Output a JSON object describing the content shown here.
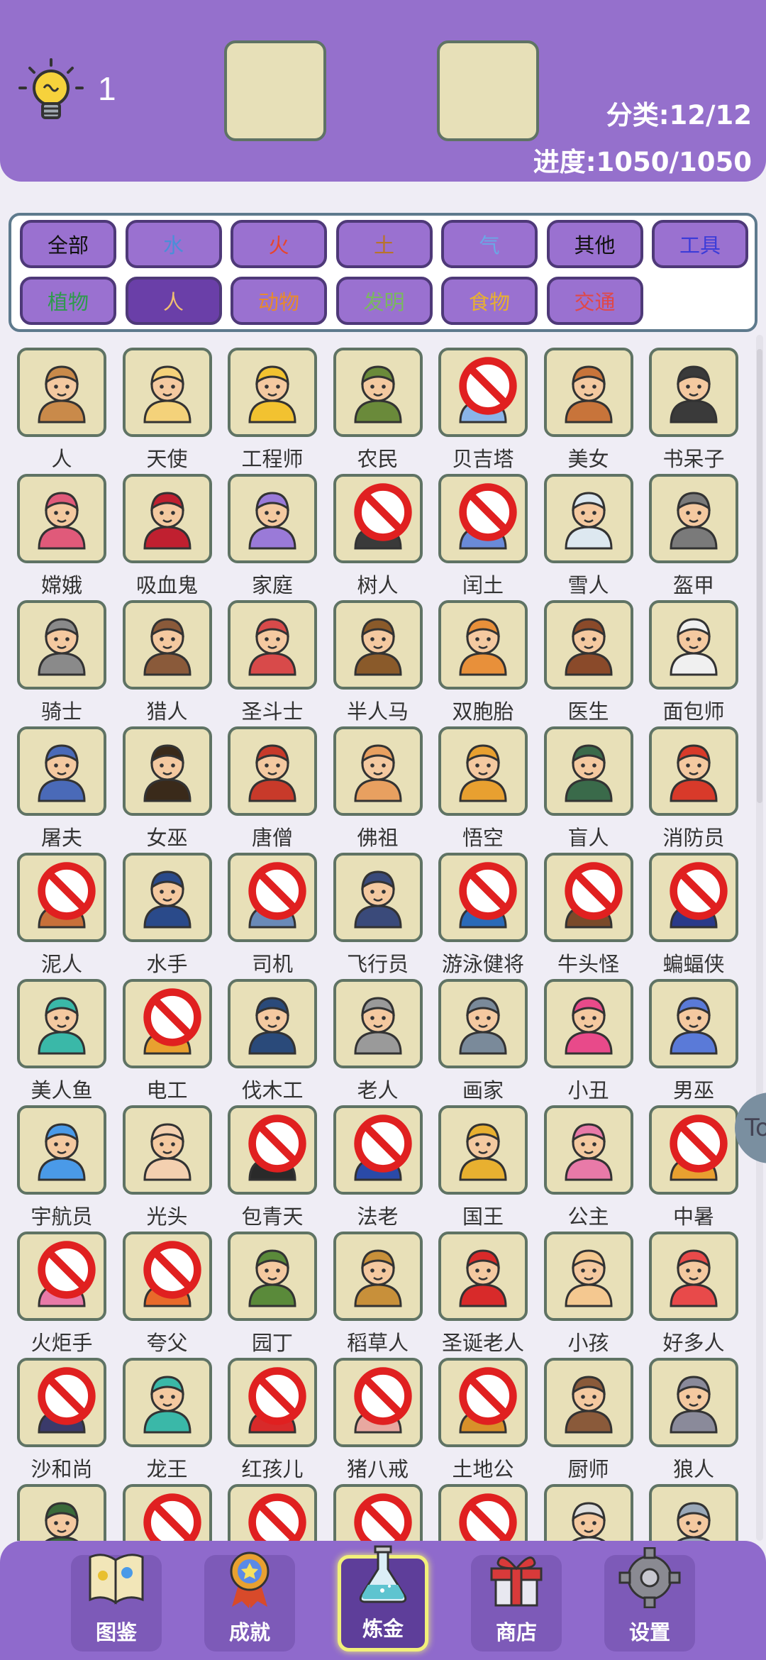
{
  "header": {
    "hint_count": "1",
    "category_stat": "分类:12/12",
    "progress_stat": "进度:1050/1050"
  },
  "categories": [
    {
      "label": "全部",
      "color": "#111111",
      "active": false
    },
    {
      "label": "水",
      "color": "#4a8fd8",
      "active": false
    },
    {
      "label": "火",
      "color": "#e8452c",
      "active": false
    },
    {
      "label": "土",
      "color": "#b8742a",
      "active": false
    },
    {
      "label": "气",
      "color": "#6aa8e6",
      "active": false
    },
    {
      "label": "其他",
      "color": "#111111",
      "active": false
    },
    {
      "label": "工具",
      "color": "#3c3cd8",
      "active": false
    },
    {
      "label": "植物",
      "color": "#2e9a4c",
      "active": false
    },
    {
      "label": "人",
      "color": "#f2c070",
      "active": true
    },
    {
      "label": "动物",
      "color": "#e88a2c",
      "active": false
    },
    {
      "label": "发明",
      "color": "#7ab860",
      "active": false
    },
    {
      "label": "食物",
      "color": "#e8b030",
      "active": false
    },
    {
      "label": "交通",
      "color": "#e04848",
      "active": false
    }
  ],
  "items": [
    {
      "label": "人",
      "icon": "farmer-man-icon",
      "banned": false,
      "color": "#c98a4a"
    },
    {
      "label": "天使",
      "icon": "angel-icon",
      "banned": false,
      "color": "#f4d27a"
    },
    {
      "label": "工程师",
      "icon": "engineer-icon",
      "banned": false,
      "color": "#f2c230"
    },
    {
      "label": "农民",
      "icon": "farmer-icon",
      "banned": false,
      "color": "#6a8a3a"
    },
    {
      "label": "贝吉塔",
      "icon": "vegeta-icon",
      "banned": true,
      "color": "#8ab4e8"
    },
    {
      "label": "美女",
      "icon": "beauty-icon",
      "banned": false,
      "color": "#c8743a"
    },
    {
      "label": "书呆子",
      "icon": "nerd-icon",
      "banned": false,
      "color": "#3a3a3a"
    },
    {
      "label": "嫦娥",
      "icon": "change-goddess-icon",
      "banned": false,
      "color": "#e05a7a"
    },
    {
      "label": "吸血鬼",
      "icon": "vampire-icon",
      "banned": false,
      "color": "#c02030"
    },
    {
      "label": "家庭",
      "icon": "family-icon",
      "banned": false,
      "color": "#9a7ad8"
    },
    {
      "label": "树人",
      "icon": "tree-man-icon",
      "banned": true,
      "color": "#3a3a3a"
    },
    {
      "label": "闰土",
      "icon": "runtu-icon",
      "banned": true,
      "color": "#6a8ad8"
    },
    {
      "label": "雪人",
      "icon": "snowman-icon",
      "banned": false,
      "color": "#dde8f0"
    },
    {
      "label": "盔甲",
      "icon": "armor-icon",
      "banned": false,
      "color": "#7a7a7a"
    },
    {
      "label": "骑士",
      "icon": "knight-icon",
      "banned": false,
      "color": "#8a8a8a"
    },
    {
      "label": "猎人",
      "icon": "hunter-icon",
      "banned": false,
      "color": "#8a5a3a"
    },
    {
      "label": "圣斗士",
      "icon": "saint-warrior-icon",
      "banned": false,
      "color": "#d84a4a"
    },
    {
      "label": "半人马",
      "icon": "centaur-icon",
      "banned": false,
      "color": "#8a5a2a"
    },
    {
      "label": "双胞胎",
      "icon": "twins-icon",
      "banned": false,
      "color": "#e8903a"
    },
    {
      "label": "医生",
      "icon": "doctor-icon",
      "banned": false,
      "color": "#8a4a2a"
    },
    {
      "label": "面包师",
      "icon": "baker-icon",
      "banned": false,
      "color": "#f0f0f0"
    },
    {
      "label": "屠夫",
      "icon": "butcher-icon",
      "banned": false,
      "color": "#4a6ab8"
    },
    {
      "label": "女巫",
      "icon": "witch-icon",
      "banned": false,
      "color": "#3a2a1a"
    },
    {
      "label": "唐僧",
      "icon": "monk-icon",
      "banned": false,
      "color": "#c83a2a"
    },
    {
      "label": "佛祖",
      "icon": "buddha-icon",
      "banned": false,
      "color": "#e8a060"
    },
    {
      "label": "悟空",
      "icon": "wukong-icon",
      "banned": false,
      "color": "#e8a030"
    },
    {
      "label": "盲人",
      "icon": "blind-man-icon",
      "banned": false,
      "color": "#3a6a4a"
    },
    {
      "label": "消防员",
      "icon": "firefighter-icon",
      "banned": false,
      "color": "#d83a2a"
    },
    {
      "label": "泥人",
      "icon": "mud-man-icon",
      "banned": true,
      "color": "#c8703a"
    },
    {
      "label": "水手",
      "icon": "sailor-icon",
      "banned": false,
      "color": "#2a4a8a"
    },
    {
      "label": "司机",
      "icon": "driver-icon",
      "banned": true,
      "color": "#6a8ab8"
    },
    {
      "label": "飞行员",
      "icon": "pilot-icon",
      "banned": false,
      "color": "#3a4a7a"
    },
    {
      "label": "游泳健将",
      "icon": "swimmer-icon",
      "banned": true,
      "color": "#2a6ab8"
    },
    {
      "label": "牛头怪",
      "icon": "minotaur-icon",
      "banned": true,
      "color": "#7a4a2a"
    },
    {
      "label": "蝙蝠侠",
      "icon": "batman-icon",
      "banned": true,
      "color": "#2a3a8a"
    },
    {
      "label": "美人鱼",
      "icon": "mermaid-icon",
      "banned": false,
      "color": "#3ab8a8"
    },
    {
      "label": "电工",
      "icon": "electrician-icon",
      "banned": true,
      "color": "#e8a030"
    },
    {
      "label": "伐木工",
      "icon": "lumberjack-icon",
      "banned": false,
      "color": "#2a4a7a"
    },
    {
      "label": "老人",
      "icon": "old-woman-icon",
      "banned": false,
      "color": "#9a9a9a"
    },
    {
      "label": "画家",
      "icon": "painter-icon",
      "banned": false,
      "color": "#7a8a9a"
    },
    {
      "label": "小丑",
      "icon": "clown-icon",
      "banned": false,
      "color": "#e84a8a"
    },
    {
      "label": "男巫",
      "icon": "wizard-icon",
      "banned": false,
      "color": "#5a7ad8"
    },
    {
      "label": "宇航员",
      "icon": "astronaut-icon",
      "banned": false,
      "color": "#4a9ae8"
    },
    {
      "label": "光头",
      "icon": "bald-icon",
      "banned": false,
      "color": "#f4d0b0"
    },
    {
      "label": "包青天",
      "icon": "bao-qingtian-icon",
      "banned": true,
      "color": "#2a2a2a"
    },
    {
      "label": "法老",
      "icon": "pharaoh-icon",
      "banned": true,
      "color": "#2a4aa8"
    },
    {
      "label": "国王",
      "icon": "king-icon",
      "banned": false,
      "color": "#e8b030"
    },
    {
      "label": "公主",
      "icon": "princess-icon",
      "banned": false,
      "color": "#e87aa8"
    },
    {
      "label": "中暑",
      "icon": "heatstroke-icon",
      "banned": true,
      "color": "#e8a030"
    },
    {
      "label": "火炬手",
      "icon": "torch-bearer-icon",
      "banned": true,
      "color": "#e87aa8"
    },
    {
      "label": "夸父",
      "icon": "kuafu-icon",
      "banned": true,
      "color": "#e86a2a"
    },
    {
      "label": "园丁",
      "icon": "gardener-icon",
      "banned": false,
      "color": "#5a8a3a"
    },
    {
      "label": "稻草人",
      "icon": "scarecrow-icon",
      "banned": false,
      "color": "#c8903a"
    },
    {
      "label": "圣诞老人",
      "icon": "santa-icon",
      "banned": false,
      "color": "#d82a2a"
    },
    {
      "label": "小孩",
      "icon": "baby-icon",
      "banned": false,
      "color": "#f4c890"
    },
    {
      "label": "好多人",
      "icon": "crowd-icon",
      "banned": false,
      "color": "#e84a4a"
    },
    {
      "label": "沙和尚",
      "icon": "sha-heshang-icon",
      "banned": true,
      "color": "#3a3a6a"
    },
    {
      "label": "龙王",
      "icon": "dragon-king-icon",
      "banned": false,
      "color": "#3ab8a8"
    },
    {
      "label": "红孩儿",
      "icon": "red-boy-icon",
      "banned": true,
      "color": "#d82a2a"
    },
    {
      "label": "猪八戒",
      "icon": "zhu-bajie-icon",
      "banned": true,
      "color": "#e8a8a0"
    },
    {
      "label": "土地公",
      "icon": "earth-god-icon",
      "banned": true,
      "color": "#d8902a"
    },
    {
      "label": "厨师",
      "icon": "chef-icon",
      "banned": false,
      "color": "#8a5a3a"
    },
    {
      "label": "狼人",
      "icon": "werewolf-icon",
      "banned": false,
      "color": "#8a8a9a"
    },
    {
      "label": "",
      "icon": "dancer-icon",
      "banned": false,
      "color": "#3a6a3a"
    },
    {
      "label": "",
      "icon": "robot-car-icon",
      "banned": true,
      "color": "#e8c030"
    },
    {
      "label": "",
      "icon": "mummy-icon",
      "banned": true,
      "color": "#f0f0f0"
    },
    {
      "label": "",
      "icon": "zombie-icon",
      "banned": true,
      "color": "#5ab0a0"
    },
    {
      "label": "",
      "icon": "gentleman-icon",
      "banned": true,
      "color": "#3a3a3a"
    },
    {
      "label": "",
      "icon": "skeleton-icon",
      "banned": false,
      "color": "#e0e0e0"
    },
    {
      "label": "",
      "icon": "robot-icon",
      "banned": false,
      "color": "#9aa8b8"
    }
  ],
  "side_tab": "To",
  "nav": [
    {
      "label": "图鉴",
      "icon": "book-icon",
      "active": false
    },
    {
      "label": "成就",
      "icon": "medal-icon",
      "active": false
    },
    {
      "label": "炼金",
      "icon": "flask-icon",
      "active": true
    },
    {
      "label": "商店",
      "icon": "gift-icon",
      "active": false
    },
    {
      "label": "设置",
      "icon": "gear-icon",
      "active": false
    }
  ]
}
